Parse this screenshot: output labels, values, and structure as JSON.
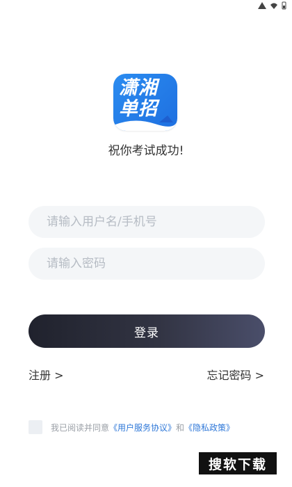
{
  "status_bar": {
    "wifi_icon": "wifi-icon",
    "signal_icon": "signal-icon",
    "battery_icon": "battery-icon"
  },
  "logo": {
    "text_line1": "潇湘",
    "text_line2": "单招"
  },
  "slogan": "祝你考试成功!",
  "form": {
    "username_placeholder": "请输入用户名/手机号",
    "password_placeholder": "请输入密码",
    "login_label": "登录"
  },
  "links": {
    "register": "注册 >",
    "forgot_password": "忘记密码 >"
  },
  "agreement": {
    "prefix": "我已阅读并同意",
    "service_link": "《用户服务协议》",
    "conjunction": "和",
    "privacy_link": "《隐私政策》"
  },
  "watermark": "搜软下载",
  "colors": {
    "logo_blue": "#2b8cf0",
    "button_dark": "#20222d",
    "link_blue": "#2f78d8"
  }
}
